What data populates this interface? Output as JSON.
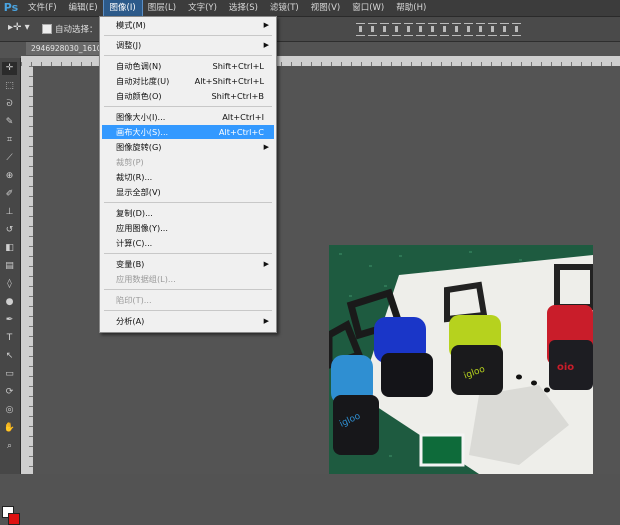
{
  "app": {
    "logo": "Ps"
  },
  "menubar": {
    "items": [
      "文件(F)",
      "编辑(E)",
      "图像(I)",
      "图层(L)",
      "文字(Y)",
      "选择(S)",
      "滤镜(T)",
      "视图(V)",
      "窗口(W)",
      "帮助(H)"
    ],
    "active_index": 2
  },
  "options_bar": {
    "auto_select_label": "自动选择：",
    "tool_icon": "move-tool-icon"
  },
  "document": {
    "tab_title": "2946928030_1610"
  },
  "image_menu": {
    "items": [
      {
        "label": "模式(M)",
        "shortcut": "",
        "submenu": true,
        "disabled": false
      },
      {
        "label": "调整(J)",
        "shortcut": "",
        "submenu": true,
        "disabled": false
      },
      {
        "label": "自动色调(N)",
        "shortcut": "Shift+Ctrl+L",
        "submenu": false,
        "disabled": false
      },
      {
        "label": "自动对比度(U)",
        "shortcut": "Alt+Shift+Ctrl+L",
        "submenu": false,
        "disabled": false
      },
      {
        "label": "自动颜色(O)",
        "shortcut": "Shift+Ctrl+B",
        "submenu": false,
        "disabled": false
      },
      {
        "label": "图像大小(I)...",
        "shortcut": "Alt+Ctrl+I",
        "submenu": false,
        "disabled": false
      },
      {
        "label": "画布大小(S)...",
        "shortcut": "Alt+Ctrl+C",
        "submenu": false,
        "disabled": false,
        "highlighted": true
      },
      {
        "label": "图像旋转(G)",
        "shortcut": "",
        "submenu": true,
        "disabled": false
      },
      {
        "label": "裁剪(P)",
        "shortcut": "",
        "submenu": false,
        "disabled": true
      },
      {
        "label": "裁切(R)...",
        "shortcut": "",
        "submenu": false,
        "disabled": false
      },
      {
        "label": "显示全部(V)",
        "shortcut": "",
        "submenu": false,
        "disabled": false
      },
      {
        "label": "复制(D)...",
        "shortcut": "",
        "submenu": false,
        "disabled": false
      },
      {
        "label": "应用图像(Y)...",
        "shortcut": "",
        "submenu": false,
        "disabled": false
      },
      {
        "label": "计算(C)...",
        "shortcut": "",
        "submenu": false,
        "disabled": false
      },
      {
        "label": "变量(B)",
        "shortcut": "",
        "submenu": true,
        "disabled": false
      },
      {
        "label": "应用数据组(L)...",
        "shortcut": "",
        "submenu": false,
        "disabled": true
      },
      {
        "label": "陷印(T)...",
        "shortcut": "",
        "submenu": false,
        "disabled": true
      },
      {
        "label": "分析(A)",
        "shortcut": "",
        "submenu": true,
        "disabled": false
      }
    ]
  },
  "colors": {
    "accent": "#3399ff",
    "foreground_swatch": "#ffffff",
    "background_swatch": "#dd1111"
  }
}
